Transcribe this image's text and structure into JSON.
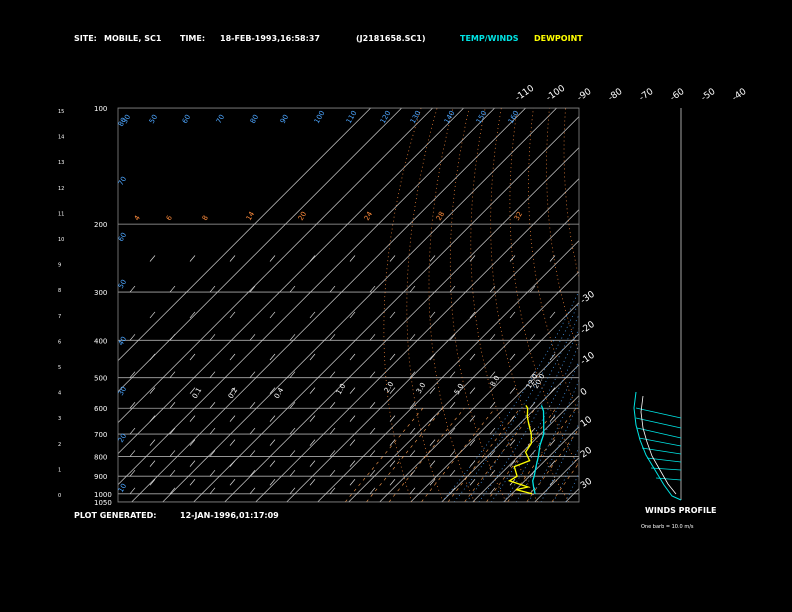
{
  "header": {
    "site_label": "SITE:",
    "site_value": "MOBILE, SC1",
    "time_label": "TIME:",
    "time_value": "18-FEB-1993,16:58:37",
    "file_id": "(J2181658.SC1)",
    "legend_temp": "TEMP/WINDS",
    "legend_dew": "DEWPOINT"
  },
  "footer": {
    "generated_label": "PLOT GENERATED:",
    "generated_value": "12-JAN-1996,01:17:09"
  },
  "winds_panel": {
    "title": "WINDS PROFILE",
    "note": "One barb = 10.0 m/s"
  },
  "colors": {
    "temp": "#00e5e5",
    "dewpoint": "#ffff00",
    "grid": "#ffffff",
    "dry_adiabat": "#ff8c3c",
    "moist_adiabat": "#4da6ff",
    "mixing_ratio": "#ffa050"
  },
  "chart_data": {
    "type": "line",
    "title": "",
    "xlabel": "",
    "ylabel": "",
    "pressure_levels_hpa": [
      "100",
      "200",
      "300",
      "400",
      "500",
      "600",
      "700",
      "800",
      "900",
      "1000",
      "1050"
    ],
    "height_km_labels": [
      "0",
      "1",
      "2",
      "3",
      "4",
      "5",
      "6",
      "7",
      "8",
      "9",
      "10",
      "11",
      "12",
      "13",
      "14",
      "15"
    ],
    "isotherm_top_labels": [
      "-110",
      "-100",
      "-90",
      "-80",
      "-70",
      "-60",
      "-50",
      "-40"
    ],
    "isotherm_right_labels": [
      "-30",
      "-20",
      "-10",
      "0",
      "10",
      "20",
      "30"
    ],
    "theta_labels_left": [
      "80",
      "70",
      "60",
      "50",
      "40",
      "30",
      "20",
      "10"
    ],
    "theta_labels_top": [
      "30",
      "50",
      "60",
      "70",
      "80",
      "90",
      "100",
      "110",
      "120",
      "130",
      "140",
      "150",
      "160"
    ],
    "mixing_ratio_labels": [
      "0.1",
      "0.2",
      "0.4",
      "1.0",
      "2.0",
      "3.0",
      "5.0",
      "8.0",
      "12.0",
      "20.0"
    ],
    "orange_labels_200": [
      "4",
      "6",
      "8",
      "14",
      "20",
      "24",
      "28",
      "32"
    ],
    "series": [
      {
        "name": "TEMP/WINDS",
        "points": [
          {
            "p": 1000,
            "t": 17.5
          },
          {
            "p": 960,
            "t": 14.8
          },
          {
            "p": 925,
            "t": 12.5
          },
          {
            "p": 900,
            "t": 11.5
          },
          {
            "p": 850,
            "t": 9.0
          },
          {
            "p": 800,
            "t": 6.5
          },
          {
            "p": 750,
            "t": 3.5
          },
          {
            "p": 700,
            "t": 1.0
          },
          {
            "p": 650,
            "t": -3.0
          },
          {
            "p": 610,
            "t": -6.5
          },
          {
            "p": 590,
            "t": -9.0
          }
        ]
      },
      {
        "name": "DEWPOINT",
        "points": [
          {
            "p": 1000,
            "t": 16.5
          },
          {
            "p": 975,
            "t": 10.0
          },
          {
            "p": 960,
            "t": 13.0
          },
          {
            "p": 925,
            "t": 5.0
          },
          {
            "p": 900,
            "t": 6.0
          },
          {
            "p": 850,
            "t": 2.0
          },
          {
            "p": 820,
            "t": 5.0
          },
          {
            "p": 780,
            "t": 1.0
          },
          {
            "p": 740,
            "t": 0.0
          },
          {
            "p": 700,
            "t": -3.0
          },
          {
            "p": 660,
            "t": -7.0
          },
          {
            "p": 630,
            "t": -10.0
          },
          {
            "p": 600,
            "t": -12.5
          },
          {
            "p": 590,
            "t": -14.0
          }
        ]
      }
    ],
    "ylim": [
      1050,
      100
    ],
    "y_scale": "log",
    "skew": true,
    "grid": true
  }
}
